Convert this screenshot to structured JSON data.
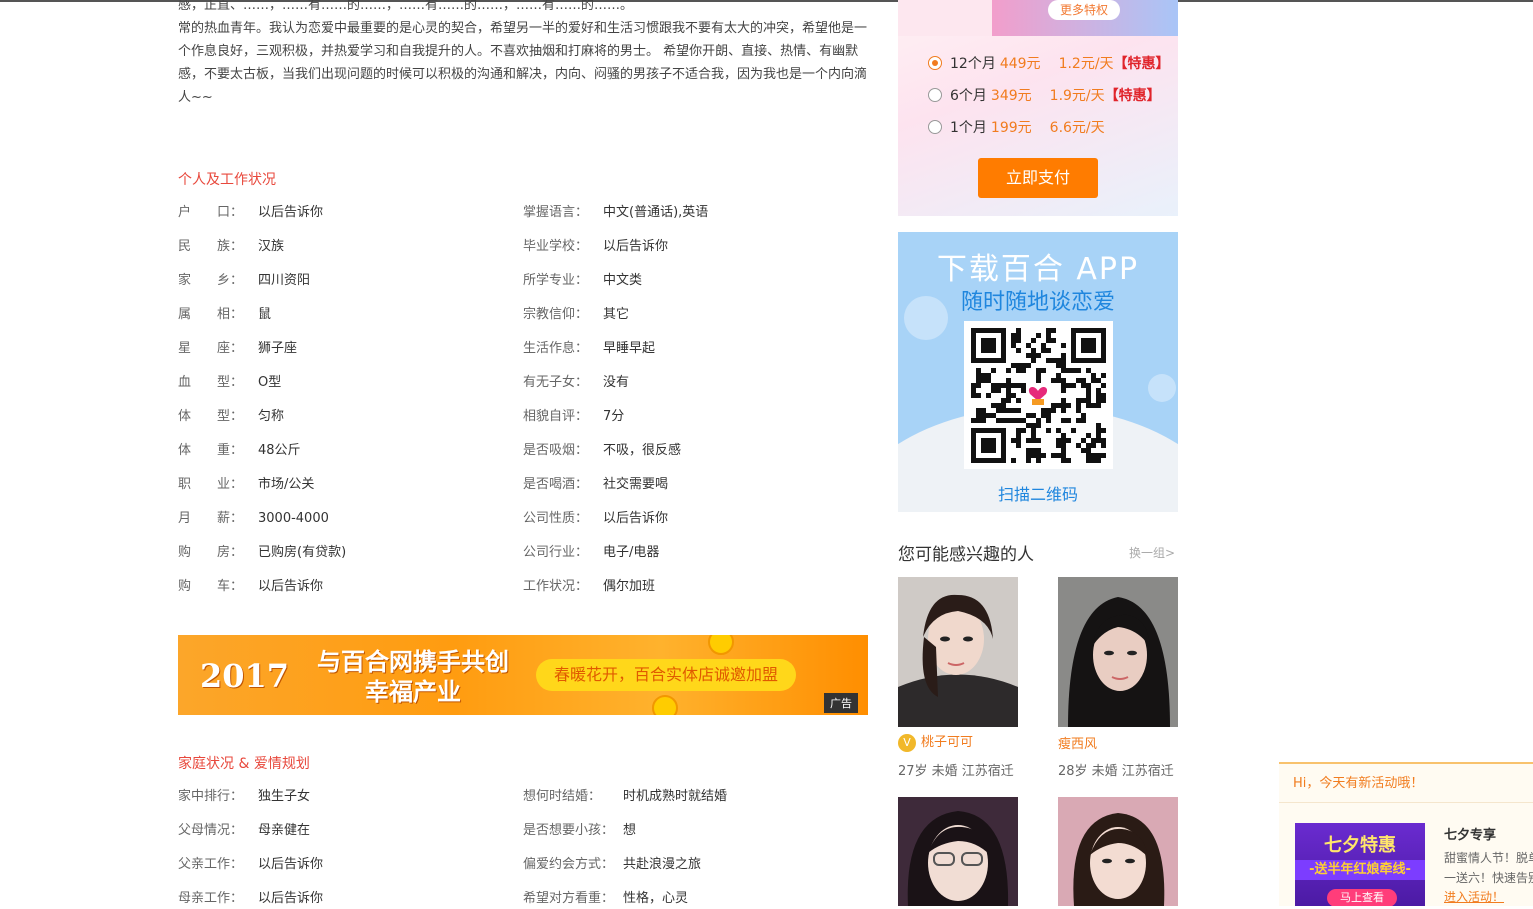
{
  "intro": {
    "lines": [
      "感，正直、……，……有……的……，……有……的……，……有……的……。",
      "常的热血青年。我认为恋爱中最重要的是心灵的契合，希望另一半的爱好和生活习惯跟我不要有太大的冲突，希望他是一",
      "个作息良好，三观积极，并热爱学习和自我提升的人。不喜欢抽烟和打麻将的男士。 希望你开朗、直接、热情、有幽默",
      "感，不要太古板，当我们出现问题的时候可以积极的沟通和解决，内向、闷骚的男孩子不适合我，因为我也是一个内向滴",
      "人~~"
    ]
  },
  "personal": {
    "title": "个人及工作状况",
    "left": [
      {
        "k": "户　　口：",
        "v": "以后告诉你"
      },
      {
        "k": "民　　族：",
        "v": "汉族"
      },
      {
        "k": "家　　乡：",
        "v": "四川资阳"
      },
      {
        "k": "属　　相：",
        "v": "鼠"
      },
      {
        "k": "星　　座：",
        "v": "狮子座"
      },
      {
        "k": "血　　型：",
        "v": "O型"
      },
      {
        "k": "体　　型：",
        "v": "匀称"
      },
      {
        "k": "体　　重：",
        "v": "48公斤"
      },
      {
        "k": "职　　业：",
        "v": "市场/公关"
      },
      {
        "k": "月　　薪：",
        "v": "3000-4000"
      },
      {
        "k": "购　　房：",
        "v": "已购房(有贷款)"
      },
      {
        "k": "购　　车：",
        "v": "以后告诉你"
      }
    ],
    "right": [
      {
        "k": "掌握语言：",
        "v": "中文(普通话),英语"
      },
      {
        "k": "毕业学校：",
        "v": "以后告诉你"
      },
      {
        "k": "所学专业：",
        "v": "中文类"
      },
      {
        "k": "宗教信仰：",
        "v": "其它"
      },
      {
        "k": "生活作息：",
        "v": "早睡早起"
      },
      {
        "k": "有无子女：",
        "v": "没有"
      },
      {
        "k": "相貌自评：",
        "v": "7分"
      },
      {
        "k": "是否吸烟：",
        "v": "不吸，很反感"
      },
      {
        "k": "是否喝酒：",
        "v": "社交需要喝"
      },
      {
        "k": "公司性质：",
        "v": "以后告诉你"
      },
      {
        "k": "公司行业：",
        "v": "电子/电器"
      },
      {
        "k": "工作状况：",
        "v": "偶尔加班"
      }
    ]
  },
  "ad_banner": {
    "year": "2017",
    "headline_1": "与百合网携手共创",
    "headline_2": "幸福产业",
    "pill": "春暖花开，百合实体店诚邀加盟",
    "tag": "广告"
  },
  "family": {
    "title": "家庭状况 & 爱情规划",
    "left": [
      {
        "k": "家中排行：",
        "v": "独生子女"
      },
      {
        "k": "父母情况：",
        "v": "母亲健在"
      },
      {
        "k": "父亲工作：",
        "v": "以后告诉你"
      },
      {
        "k": "母亲工作：",
        "v": "以后告诉你"
      }
    ],
    "right": [
      {
        "k": "想何时结婚：",
        "v": "时机成熟时就结婚"
      },
      {
        "k": "是否想要小孩：",
        "v": "想"
      },
      {
        "k": "偏爱约会方式：",
        "v": "共赴浪漫之旅"
      },
      {
        "k": "希望对方看重：",
        "v": "性格，心灵"
      }
    ]
  },
  "vip": {
    "more_label": "更多特权",
    "plans": [
      {
        "duration": "12个月",
        "price": "449元",
        "daily": "1.2元/天",
        "tag": "【特惠】",
        "selected": true
      },
      {
        "duration": "6个月",
        "price": "349元",
        "daily": "1.9元/天",
        "tag": "【特惠】",
        "selected": false
      },
      {
        "duration": "1个月",
        "price": "199元",
        "daily": "6.6元/天",
        "tag": "",
        "selected": false
      }
    ],
    "pay_label": "立即支付"
  },
  "app": {
    "title": "下载百合 APP",
    "subtitle": "随时随地谈恋爱",
    "scan": "扫描二维码"
  },
  "recommend": {
    "title": "您可能感兴趣的人",
    "more": "换一组>",
    "people": [
      {
        "name": "桃子可可",
        "meta": "27岁 未婚 江苏宿迁",
        "vip": true
      },
      {
        "name": "瘦西风",
        "meta": "28岁 未婚 江苏宿迁",
        "vip": false
      }
    ]
  },
  "popup": {
    "hi": "Hi，今天有新活动哦！",
    "img_title": "七夕特惠",
    "img_sub": "-送半年红娘牵线-",
    "img_btn": "马上查看",
    "title": "七夕专享",
    "desc_1": "甜蜜情人节！脱单",
    "desc_2": "一送六！快速告别",
    "link": "进入活动！"
  },
  "colors": {
    "accent": "#f17c1f",
    "section": "#e8483c",
    "link_blue": "#1f86de"
  }
}
